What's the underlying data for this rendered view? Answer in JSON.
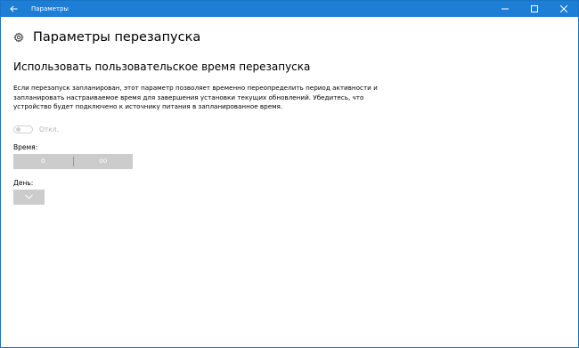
{
  "window": {
    "title": "Параметры"
  },
  "header": {
    "title": "Параметры перезапуска"
  },
  "section": {
    "title": "Использовать пользовательское время перезапуска",
    "description": "Если перезапуск запланирован, этот параметр позволяет временно переопределить период активности и запланировать настраиваемое время для завершения установки текущих обновлений. Убедитесь, что устройство будет подключено к источнику питания в запланированное время."
  },
  "toggle": {
    "label": "Откл.",
    "state": "off"
  },
  "time": {
    "label": "Время:",
    "hour": "0",
    "minute": "00"
  },
  "day": {
    "label": "День:",
    "value": ""
  },
  "colors": {
    "titlebar": "#1e7ed6",
    "disabled_control": "#cccccc",
    "disabled_text": "#b0b0b0"
  },
  "icons": [
    "back-arrow-icon",
    "minimize-icon",
    "maximize-icon",
    "close-icon",
    "gear-icon",
    "chevron-down-icon"
  ]
}
